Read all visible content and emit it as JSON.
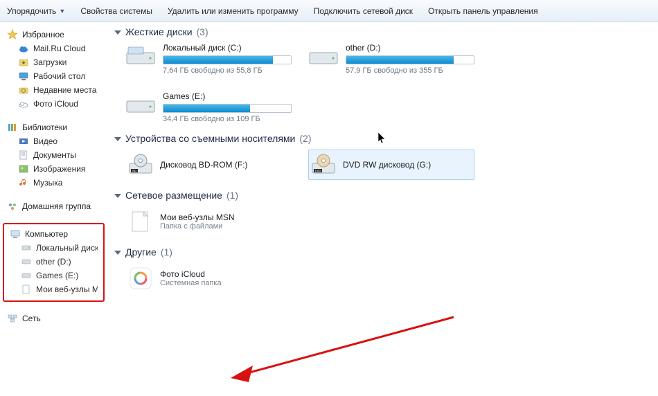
{
  "toolbar": {
    "organize": "Упорядочить",
    "properties": "Свойства системы",
    "uninstall": "Удалить или изменить программу",
    "map_drive": "Подключить сетевой диск",
    "control_panel": "Открыть панель управления"
  },
  "sidebar": {
    "favorites": {
      "title": "Избранное",
      "items": [
        "Mail.Ru Cloud",
        "Загрузки",
        "Рабочий стол",
        "Недавние места",
        "Фото iCloud"
      ]
    },
    "libraries": {
      "title": "Библиотеки",
      "items": [
        "Видео",
        "Документы",
        "Изображения",
        "Музыка"
      ]
    },
    "homegroup": "Домашняя группа",
    "computer": {
      "title": "Компьютер",
      "items": [
        "Локальный диск (C:)",
        "other (D:)",
        "Games (E:)",
        "Мои веб-узлы MSN"
      ]
    },
    "network": "Сеть"
  },
  "sections": {
    "hdd": {
      "title": "Жесткие диски",
      "count": "(3)",
      "drives": [
        {
          "name": "Локальный диск (C:)",
          "free": "7,64 ГБ свободно из 55,8 ГБ",
          "fill": 86
        },
        {
          "name": "other (D:)",
          "free": "57,9 ГБ свободно из 355 ГБ",
          "fill": 84
        },
        {
          "name": "Games (E:)",
          "free": "34,4 ГБ свободно из 109 ГБ",
          "fill": 68
        }
      ]
    },
    "removable": {
      "title": "Устройства со съемными носителями",
      "count": "(2)",
      "items": [
        {
          "name": "Дисковод BD-ROM (F:)",
          "sub": ""
        },
        {
          "name": "DVD RW дисковод (G:)",
          "sub": ""
        }
      ]
    },
    "netloc": {
      "title": "Сетевое размещение",
      "count": "(1)",
      "items": [
        {
          "name": "Мои веб-узлы MSN",
          "sub": "Папка с файлами"
        }
      ]
    },
    "other": {
      "title": "Другие",
      "count": "(1)",
      "items": [
        {
          "name": "Фото iCloud",
          "sub": "Системная папка"
        }
      ]
    }
  }
}
